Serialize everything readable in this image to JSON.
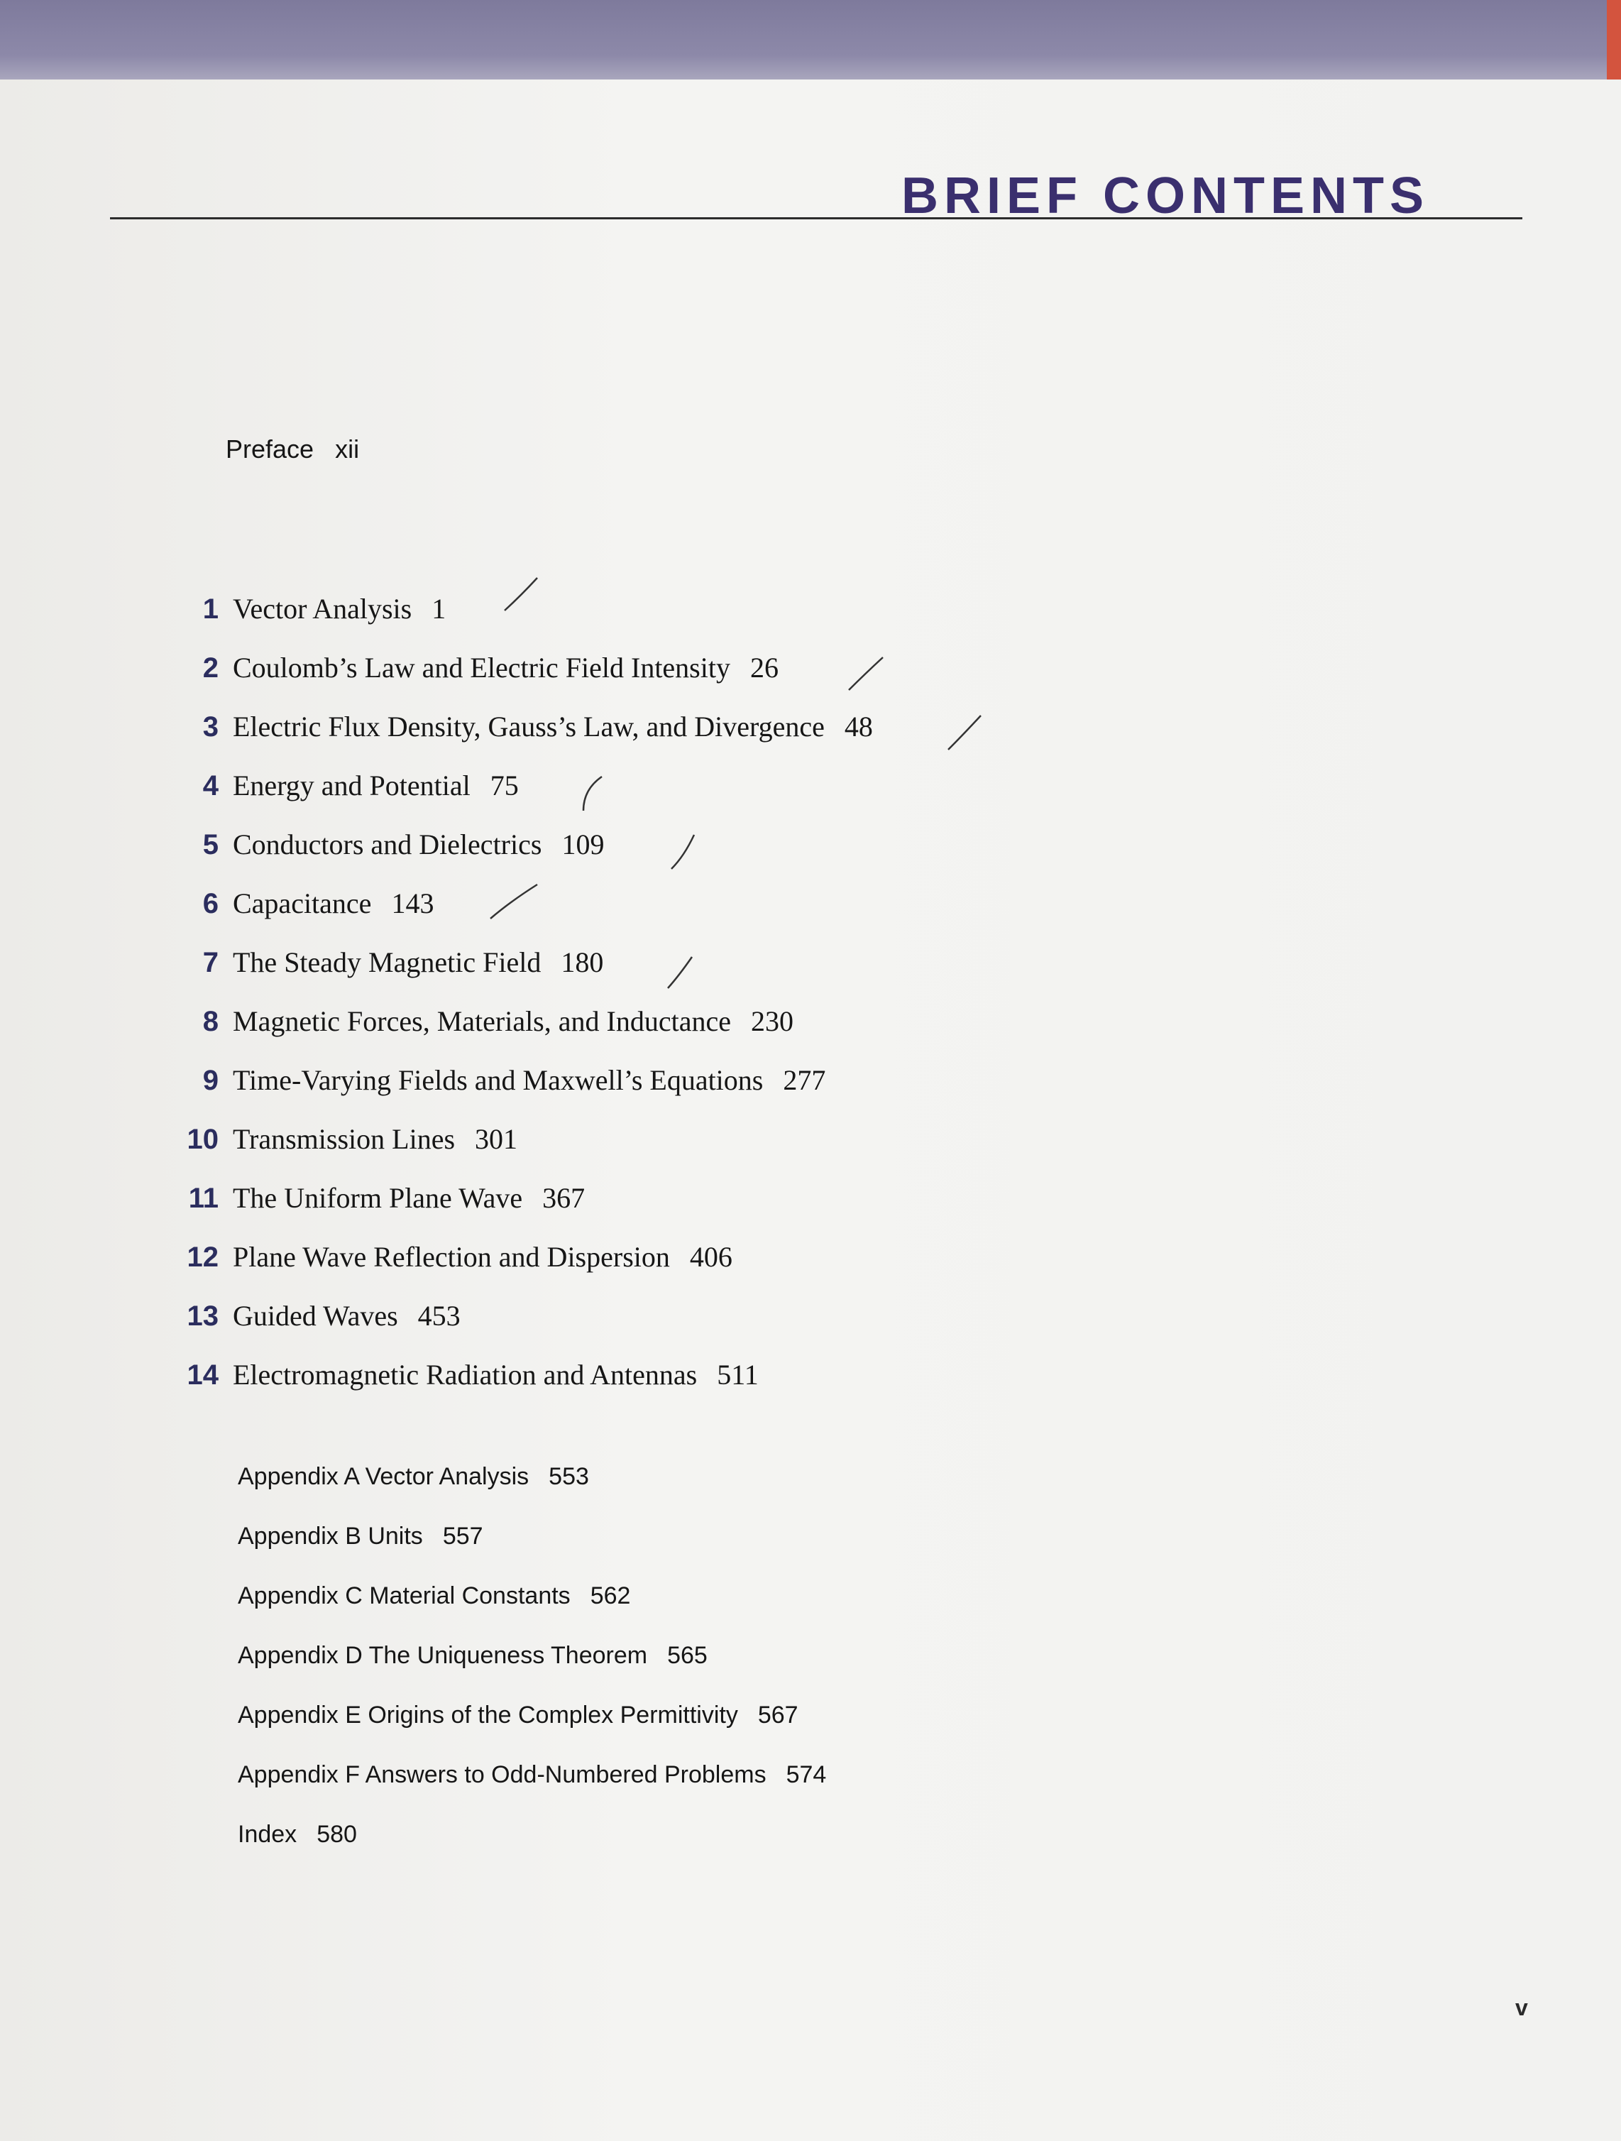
{
  "header": {
    "title": "BRIEF CONTENTS"
  },
  "preface": {
    "label": "Preface",
    "page": "xii"
  },
  "chapters": [
    {
      "num": "1",
      "title": "Vector Analysis",
      "page": "1"
    },
    {
      "num": "2",
      "title": "Coulomb’s Law and Electric Field Intensity",
      "page": "26"
    },
    {
      "num": "3",
      "title": "Electric Flux Density, Gauss’s Law, and Divergence",
      "page": "48"
    },
    {
      "num": "4",
      "title": "Energy and Potential",
      "page": "75"
    },
    {
      "num": "5",
      "title": "Conductors and Dielectrics",
      "page": "109"
    },
    {
      "num": "6",
      "title": "Capacitance",
      "page": "143"
    },
    {
      "num": "7",
      "title": "The Steady Magnetic Field",
      "page": "180"
    },
    {
      "num": "8",
      "title": "Magnetic Forces, Materials, and Inductance",
      "page": "230"
    },
    {
      "num": "9",
      "title": "Time-Varying Fields and Maxwell’s Equations",
      "page": "277"
    },
    {
      "num": "10",
      "title": "Transmission Lines",
      "page": "301"
    },
    {
      "num": "11",
      "title": "The Uniform Plane Wave",
      "page": "367"
    },
    {
      "num": "12",
      "title": "Plane Wave Reflection and Dispersion",
      "page": "406"
    },
    {
      "num": "13",
      "title": "Guided Waves",
      "page": "453"
    },
    {
      "num": "14",
      "title": "Electromagnetic Radiation and Antennas",
      "page": "511"
    }
  ],
  "appendices": [
    {
      "title": "Appendix A Vector Analysis",
      "page": "553"
    },
    {
      "title": "Appendix B Units",
      "page": "557"
    },
    {
      "title": "Appendix C Material Constants",
      "page": "562"
    },
    {
      "title": "Appendix D The Uniqueness Theorem",
      "page": "565"
    },
    {
      "title": "Appendix E Origins of the Complex Permittivity",
      "page": "567"
    },
    {
      "title": "Appendix F Answers to Odd-Numbered Problems",
      "page": "574"
    },
    {
      "title": "Index",
      "page": "580"
    }
  ],
  "folio": "v"
}
